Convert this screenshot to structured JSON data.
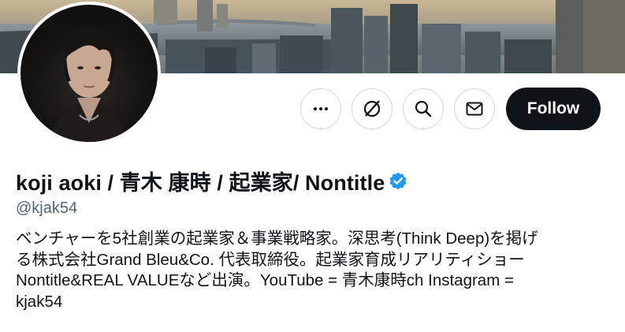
{
  "profile": {
    "display_name": "koji aoki / 青木 康時 / 起業家/ Nontitle",
    "handle": "@kjak54",
    "verified": true,
    "bio": "ベンチャーを5社創業の起業家＆事業戦略家。深思考(Think Deep)を掲げ\nる株式会社Grand Bleu&Co. 代表取締役。起業家育成リアリティショー\nNontitle&REAL VALUEなど出演。YouTube = 青木康時ch   Instagram =\nkjak54"
  },
  "actions": {
    "more_icon": "more-horizontal-icon",
    "grok_icon": "grok-icon",
    "search_icon": "search-icon",
    "message_icon": "envelope-icon",
    "follow_label": "Follow"
  },
  "colors": {
    "follow_bg": "#0f1419",
    "verified_blue": "#1d9bf0",
    "handle_gray": "#536471",
    "button_border": "#cfd9de"
  }
}
